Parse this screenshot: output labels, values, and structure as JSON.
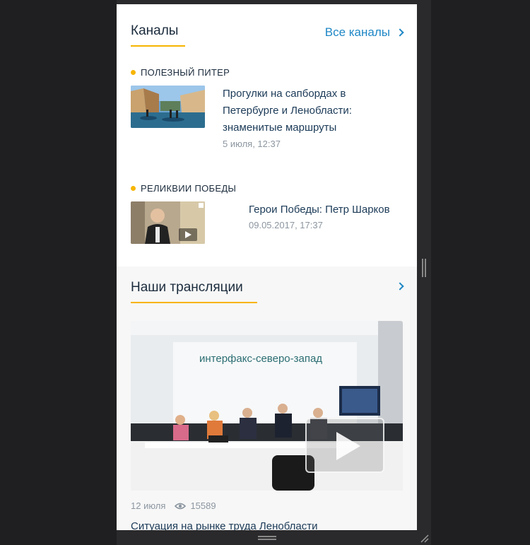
{
  "channels": {
    "title": "Каналы",
    "all_link": "Все каналы",
    "items": [
      {
        "tag": "ПОЛЕЗНЫЙ ПИТЕР",
        "title_lines": [
          "Прогулки на сапбордах в",
          "Петербурге и Ленобласти:",
          "знаменитые маршруты"
        ],
        "date": "5 июля, 12:37"
      },
      {
        "tag": "РЕЛИКВИИ ПОБЕДЫ",
        "title_lines": [
          "Герои Победы: Петр Шарков"
        ],
        "date": "09.05.2017, 17:37"
      }
    ]
  },
  "broadcasts": {
    "title": "Наши трансляции",
    "video_logo": "интерфакс-северо-запад",
    "date": "12 июля",
    "views": "15589",
    "item_title": "Ситуация на рынке труда Ленобласти"
  },
  "colors": {
    "accent": "#f7b500",
    "link": "#1e87c5",
    "text": "#1b3a57",
    "muted": "#8c96a0"
  }
}
